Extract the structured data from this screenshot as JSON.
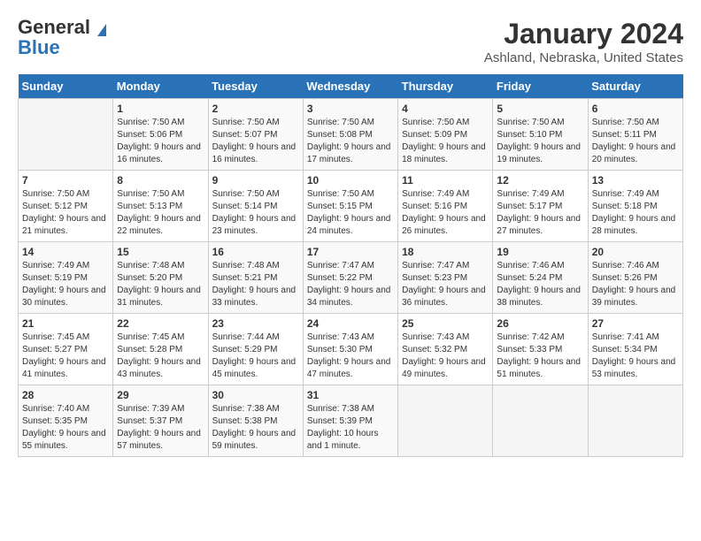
{
  "logo": {
    "general": "General",
    "blue": "Blue"
  },
  "title": {
    "month_year": "January 2024",
    "location": "Ashland, Nebraska, United States"
  },
  "days_of_week": [
    "Sunday",
    "Monday",
    "Tuesday",
    "Wednesday",
    "Thursday",
    "Friday",
    "Saturday"
  ],
  "weeks": [
    [
      {
        "day": "",
        "sunrise": "",
        "sunset": "",
        "daylight": ""
      },
      {
        "day": "1",
        "sunrise": "Sunrise: 7:50 AM",
        "sunset": "Sunset: 5:06 PM",
        "daylight": "Daylight: 9 hours and 16 minutes."
      },
      {
        "day": "2",
        "sunrise": "Sunrise: 7:50 AM",
        "sunset": "Sunset: 5:07 PM",
        "daylight": "Daylight: 9 hours and 16 minutes."
      },
      {
        "day": "3",
        "sunrise": "Sunrise: 7:50 AM",
        "sunset": "Sunset: 5:08 PM",
        "daylight": "Daylight: 9 hours and 17 minutes."
      },
      {
        "day": "4",
        "sunrise": "Sunrise: 7:50 AM",
        "sunset": "Sunset: 5:09 PM",
        "daylight": "Daylight: 9 hours and 18 minutes."
      },
      {
        "day": "5",
        "sunrise": "Sunrise: 7:50 AM",
        "sunset": "Sunset: 5:10 PM",
        "daylight": "Daylight: 9 hours and 19 minutes."
      },
      {
        "day": "6",
        "sunrise": "Sunrise: 7:50 AM",
        "sunset": "Sunset: 5:11 PM",
        "daylight": "Daylight: 9 hours and 20 minutes."
      }
    ],
    [
      {
        "day": "7",
        "sunrise": "Sunrise: 7:50 AM",
        "sunset": "Sunset: 5:12 PM",
        "daylight": "Daylight: 9 hours and 21 minutes."
      },
      {
        "day": "8",
        "sunrise": "Sunrise: 7:50 AM",
        "sunset": "Sunset: 5:13 PM",
        "daylight": "Daylight: 9 hours and 22 minutes."
      },
      {
        "day": "9",
        "sunrise": "Sunrise: 7:50 AM",
        "sunset": "Sunset: 5:14 PM",
        "daylight": "Daylight: 9 hours and 23 minutes."
      },
      {
        "day": "10",
        "sunrise": "Sunrise: 7:50 AM",
        "sunset": "Sunset: 5:15 PM",
        "daylight": "Daylight: 9 hours and 24 minutes."
      },
      {
        "day": "11",
        "sunrise": "Sunrise: 7:49 AM",
        "sunset": "Sunset: 5:16 PM",
        "daylight": "Daylight: 9 hours and 26 minutes."
      },
      {
        "day": "12",
        "sunrise": "Sunrise: 7:49 AM",
        "sunset": "Sunset: 5:17 PM",
        "daylight": "Daylight: 9 hours and 27 minutes."
      },
      {
        "day": "13",
        "sunrise": "Sunrise: 7:49 AM",
        "sunset": "Sunset: 5:18 PM",
        "daylight": "Daylight: 9 hours and 28 minutes."
      }
    ],
    [
      {
        "day": "14",
        "sunrise": "Sunrise: 7:49 AM",
        "sunset": "Sunset: 5:19 PM",
        "daylight": "Daylight: 9 hours and 30 minutes."
      },
      {
        "day": "15",
        "sunrise": "Sunrise: 7:48 AM",
        "sunset": "Sunset: 5:20 PM",
        "daylight": "Daylight: 9 hours and 31 minutes."
      },
      {
        "day": "16",
        "sunrise": "Sunrise: 7:48 AM",
        "sunset": "Sunset: 5:21 PM",
        "daylight": "Daylight: 9 hours and 33 minutes."
      },
      {
        "day": "17",
        "sunrise": "Sunrise: 7:47 AM",
        "sunset": "Sunset: 5:22 PM",
        "daylight": "Daylight: 9 hours and 34 minutes."
      },
      {
        "day": "18",
        "sunrise": "Sunrise: 7:47 AM",
        "sunset": "Sunset: 5:23 PM",
        "daylight": "Daylight: 9 hours and 36 minutes."
      },
      {
        "day": "19",
        "sunrise": "Sunrise: 7:46 AM",
        "sunset": "Sunset: 5:24 PM",
        "daylight": "Daylight: 9 hours and 38 minutes."
      },
      {
        "day": "20",
        "sunrise": "Sunrise: 7:46 AM",
        "sunset": "Sunset: 5:26 PM",
        "daylight": "Daylight: 9 hours and 39 minutes."
      }
    ],
    [
      {
        "day": "21",
        "sunrise": "Sunrise: 7:45 AM",
        "sunset": "Sunset: 5:27 PM",
        "daylight": "Daylight: 9 hours and 41 minutes."
      },
      {
        "day": "22",
        "sunrise": "Sunrise: 7:45 AM",
        "sunset": "Sunset: 5:28 PM",
        "daylight": "Daylight: 9 hours and 43 minutes."
      },
      {
        "day": "23",
        "sunrise": "Sunrise: 7:44 AM",
        "sunset": "Sunset: 5:29 PM",
        "daylight": "Daylight: 9 hours and 45 minutes."
      },
      {
        "day": "24",
        "sunrise": "Sunrise: 7:43 AM",
        "sunset": "Sunset: 5:30 PM",
        "daylight": "Daylight: 9 hours and 47 minutes."
      },
      {
        "day": "25",
        "sunrise": "Sunrise: 7:43 AM",
        "sunset": "Sunset: 5:32 PM",
        "daylight": "Daylight: 9 hours and 49 minutes."
      },
      {
        "day": "26",
        "sunrise": "Sunrise: 7:42 AM",
        "sunset": "Sunset: 5:33 PM",
        "daylight": "Daylight: 9 hours and 51 minutes."
      },
      {
        "day": "27",
        "sunrise": "Sunrise: 7:41 AM",
        "sunset": "Sunset: 5:34 PM",
        "daylight": "Daylight: 9 hours and 53 minutes."
      }
    ],
    [
      {
        "day": "28",
        "sunrise": "Sunrise: 7:40 AM",
        "sunset": "Sunset: 5:35 PM",
        "daylight": "Daylight: 9 hours and 55 minutes."
      },
      {
        "day": "29",
        "sunrise": "Sunrise: 7:39 AM",
        "sunset": "Sunset: 5:37 PM",
        "daylight": "Daylight: 9 hours and 57 minutes."
      },
      {
        "day": "30",
        "sunrise": "Sunrise: 7:38 AM",
        "sunset": "Sunset: 5:38 PM",
        "daylight": "Daylight: 9 hours and 59 minutes."
      },
      {
        "day": "31",
        "sunrise": "Sunrise: 7:38 AM",
        "sunset": "Sunset: 5:39 PM",
        "daylight": "Daylight: 10 hours and 1 minute."
      },
      {
        "day": "",
        "sunrise": "",
        "sunset": "",
        "daylight": ""
      },
      {
        "day": "",
        "sunrise": "",
        "sunset": "",
        "daylight": ""
      },
      {
        "day": "",
        "sunrise": "",
        "sunset": "",
        "daylight": ""
      }
    ]
  ]
}
